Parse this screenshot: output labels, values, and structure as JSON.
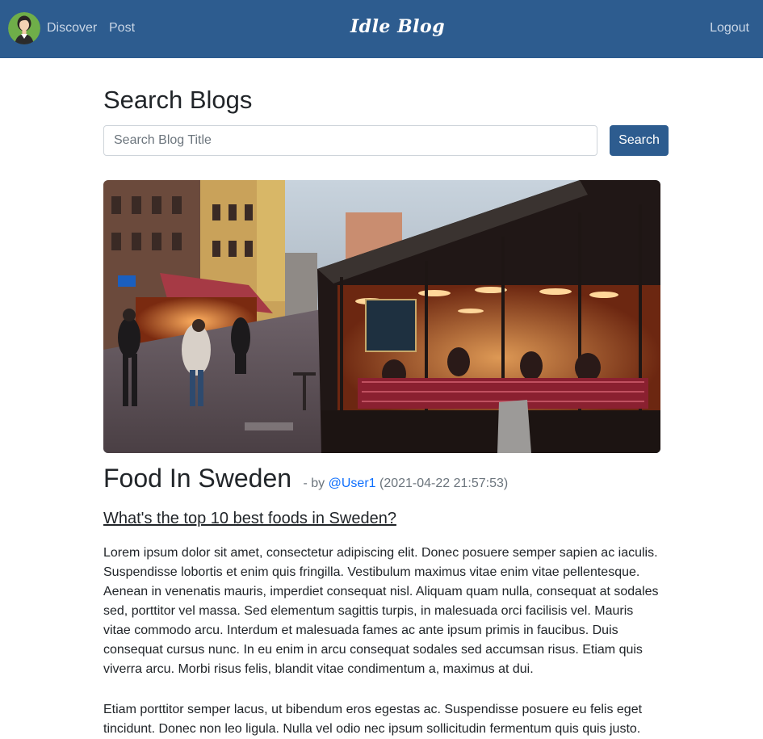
{
  "nav": {
    "discover": "Discover",
    "post": "Post",
    "brand": "Idle Blog",
    "logout": "Logout"
  },
  "search": {
    "heading": "Search Blogs",
    "placeholder": "Search Blog Title",
    "button": "Search"
  },
  "blog": {
    "title": "Food In Sweden",
    "by_prefix": "- by",
    "author": "@User1",
    "timestamp": "(2021-04-22 21:57:53)",
    "subtitle": "What's the top 10 best foods in Sweden?",
    "paragraphs": [
      "Lorem ipsum dolor sit amet, consectetur adipiscing elit. Donec posuere semper sapien ac iaculis. Suspendisse lobortis et enim quis fringilla. Vestibulum maximus vitae enim vitae pellentesque. Aenean in venenatis mauris, imperdiet consequat nisl. Aliquam quam nulla, consequat at sodales sed, porttitor vel massa. Sed elementum sagittis turpis, in malesuada orci facilisis vel. Mauris vitae commodo arcu. Interdum et malesuada fames ac ante ipsum primis in faucibus. Duis consequat cursus nunc. In eu enim in arcu consequat sodales sed accumsan risus. Etiam quis viverra arcu. Morbi risus felis, blandit vitae condimentum a, maximus at dui.",
      "Etiam porttitor semper lacus, ut bibendum eros egestas ac. Suspendisse posuere eu felis eget tincidunt. Donec non leo ligula. Nulla vel odio nec ipsum sollicitudin fermentum quis quis justo."
    ]
  },
  "colors": {
    "navbar": "#2d5c8f",
    "primary_button": "#2d5c8f",
    "link": "#0d6efd"
  },
  "icons": {
    "avatar": "user-avatar-icon"
  }
}
